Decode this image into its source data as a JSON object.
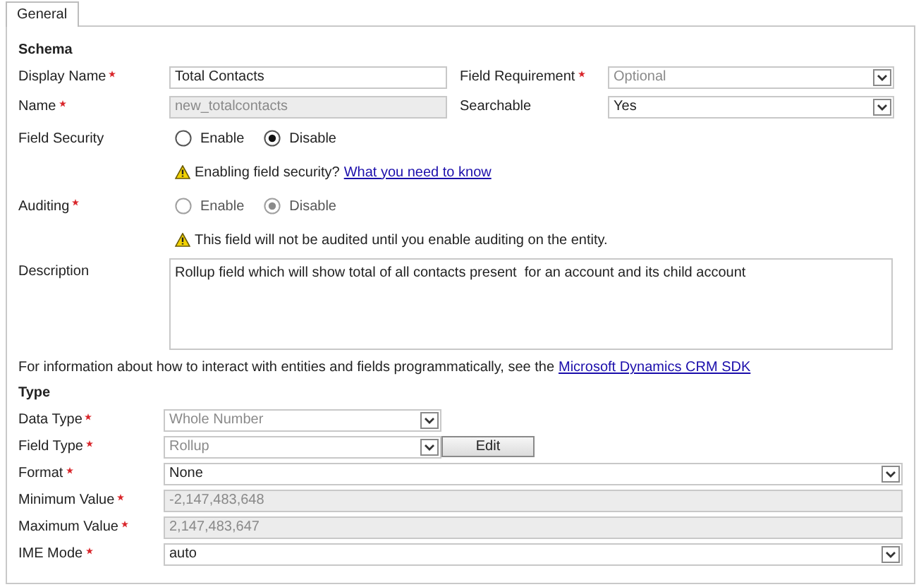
{
  "tabs": [
    {
      "label": "General",
      "selected": true
    }
  ],
  "schema": {
    "heading": "Schema",
    "rows": [
      {
        "kind": "text",
        "label": "Display Name",
        "required": true,
        "value": "Total Contacts",
        "disabled": false,
        "right": {
          "kind": "select",
          "label": "Field Requirement",
          "required": true,
          "value": "Optional",
          "disabled": true
        }
      },
      {
        "kind": "text",
        "label": "Name",
        "required": true,
        "value": "new_totalcontacts",
        "disabled": true,
        "right": {
          "kind": "select",
          "label": "Searchable",
          "required": false,
          "value": "Yes",
          "disabled": false
        }
      },
      {
        "kind": "radio",
        "label": "Field Security",
        "required": false,
        "disabled": false,
        "options": [
          {
            "label": "Enable",
            "selected": false
          },
          {
            "label": "Disable",
            "selected": true
          }
        ]
      },
      {
        "kind": "notice",
        "text": "Enabling field security?",
        "link": "What you need to know"
      },
      {
        "kind": "radio",
        "label": "Auditing",
        "required": true,
        "disabled": true,
        "options": [
          {
            "label": "Enable",
            "selected": false
          },
          {
            "label": "Disable",
            "selected": true
          }
        ]
      },
      {
        "kind": "notice",
        "text": "This field will not be audited until you enable auditing on the entity."
      },
      {
        "kind": "textarea",
        "label": "Description",
        "required": false,
        "value": "Rollup field which will show total of all contacts present  for an account and its child account",
        "disabled": false
      }
    ]
  },
  "info": {
    "text": "For information about how to interact with entities and fields programmatically, see the",
    "link": "Microsoft Dynamics CRM SDK"
  },
  "type": {
    "heading": "Type",
    "rows": [
      {
        "kind": "short-select",
        "label": "Data Type",
        "required": true,
        "value": "Whole Number",
        "disabled": true
      },
      {
        "kind": "short-select",
        "label": "Field Type",
        "required": true,
        "value": "Rollup",
        "disabled": true,
        "button": "Edit"
      },
      {
        "kind": "select",
        "label": "Format",
        "required": true,
        "value": "None",
        "disabled": false
      },
      {
        "kind": "text",
        "label": "Minimum Value",
        "required": true,
        "value": "-2,147,483,648",
        "disabled": true
      },
      {
        "kind": "text",
        "label": "Maximum Value",
        "required": true,
        "value": "2,147,483,647",
        "disabled": true
      },
      {
        "kind": "select",
        "label": "IME Mode",
        "required": true,
        "value": "auto",
        "disabled": false
      }
    ]
  }
}
